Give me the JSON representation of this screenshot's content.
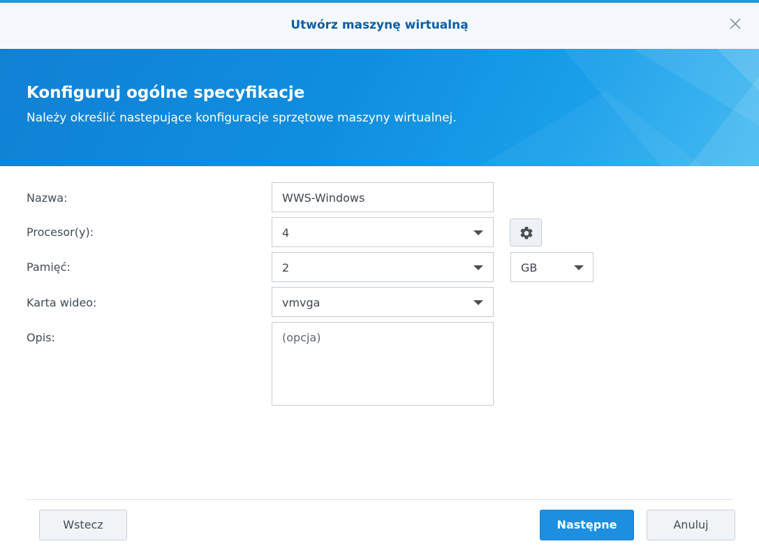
{
  "window": {
    "title": "Utwórz maszynę wirtualną",
    "close_icon": "close-icon"
  },
  "banner": {
    "heading": "Konfiguruj ogólne specyfikacje",
    "subheading": "Należy określić nastepujące konfiguracje sprzętowe maszyny wirtualnej."
  },
  "form": {
    "name": {
      "label": "Nazwa:",
      "value": "WWS-Windows"
    },
    "cpu": {
      "label": "Procesor(y):",
      "value": "4",
      "settings_icon": "gear-icon"
    },
    "memory": {
      "label": "Pamięć:",
      "value": "2",
      "unit": "GB"
    },
    "video": {
      "label": "Karta wideo:",
      "value": "vmvga"
    },
    "description": {
      "label": "Opis:",
      "placeholder": "(opcja)"
    }
  },
  "footer": {
    "back": "Wstecz",
    "next": "Następne",
    "cancel": "Anuluj"
  },
  "colors": {
    "accent": "#1d8fe0",
    "title": "#0a5fa8",
    "banner": "#1181d4"
  }
}
